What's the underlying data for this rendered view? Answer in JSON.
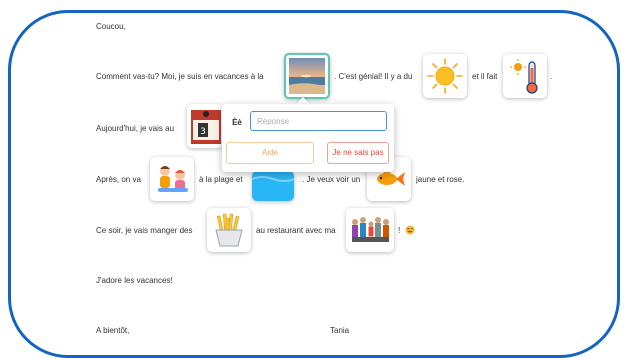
{
  "letter": {
    "greeting": "Coucou,",
    "line2": {
      "a": "Comment vas-tu? Moi, je suis en vacances à la",
      "b": ". C'est génial! Il y a du",
      "c": "et il fait",
      "d": "."
    },
    "line3": {
      "a": "Aujourd'hui, je vais au"
    },
    "line4": {
      "a": "Après, on va",
      "b": "à la plage et",
      "c": ". Je veux voir un",
      "d": "jaune et rose."
    },
    "line5": {
      "a": "Ce soir, je vais manger des",
      "b": "au restaurant avec ma",
      "c": "!"
    },
    "line6": "J'adore les vacances!",
    "closing": "A bientôt,",
    "signature": "Tania"
  },
  "icons": {
    "beach": "beach-picture",
    "sun": "sun-icon",
    "thermometer": "hot-thermometer-icon",
    "calendar": "calendar-icon",
    "kids": "children-playing-icon",
    "swim": "swimming-icon",
    "fish": "goldfish-icon",
    "fries": "french-fries-icon",
    "family": "family-icon",
    "emoji": "smiling-face-emoji"
  },
  "popover": {
    "accent_label": "Èè",
    "answer_placeholder": "Réponse",
    "help_label": "Aide",
    "dont_know_label": "Je ne sais pas"
  },
  "colors": {
    "frame": "#1565c0",
    "selected_border": "#5cc8b5",
    "input_border": "#4a90d9",
    "help": "#f0a860",
    "dont_know": "#e24848"
  }
}
